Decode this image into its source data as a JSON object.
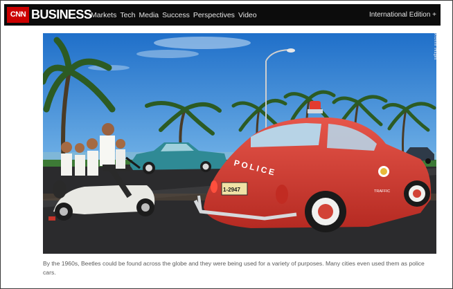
{
  "header": {
    "logo_cnn": "CNN",
    "logo_business": "BUSINESS",
    "nav": [
      "Markets",
      "Tech",
      "Media",
      "Success",
      "Perspectives",
      "Video"
    ],
    "edition": "International Edition +"
  },
  "article": {
    "photo_credit": "Archive Images",
    "photo_text": {
      "car_door": "POLICE",
      "plate": "1-2947",
      "traffic": "TRAFFIC"
    },
    "caption": "By the 1960s, Beetles could be found across the globe and they were being used for a variety of purposes. Many cities even used them as police cars."
  },
  "colors": {
    "nav_bg": "#0c0c0c",
    "cnn_red": "#cc0000",
    "car_red": "#d83a2e",
    "sky": "#2f7fd1"
  }
}
